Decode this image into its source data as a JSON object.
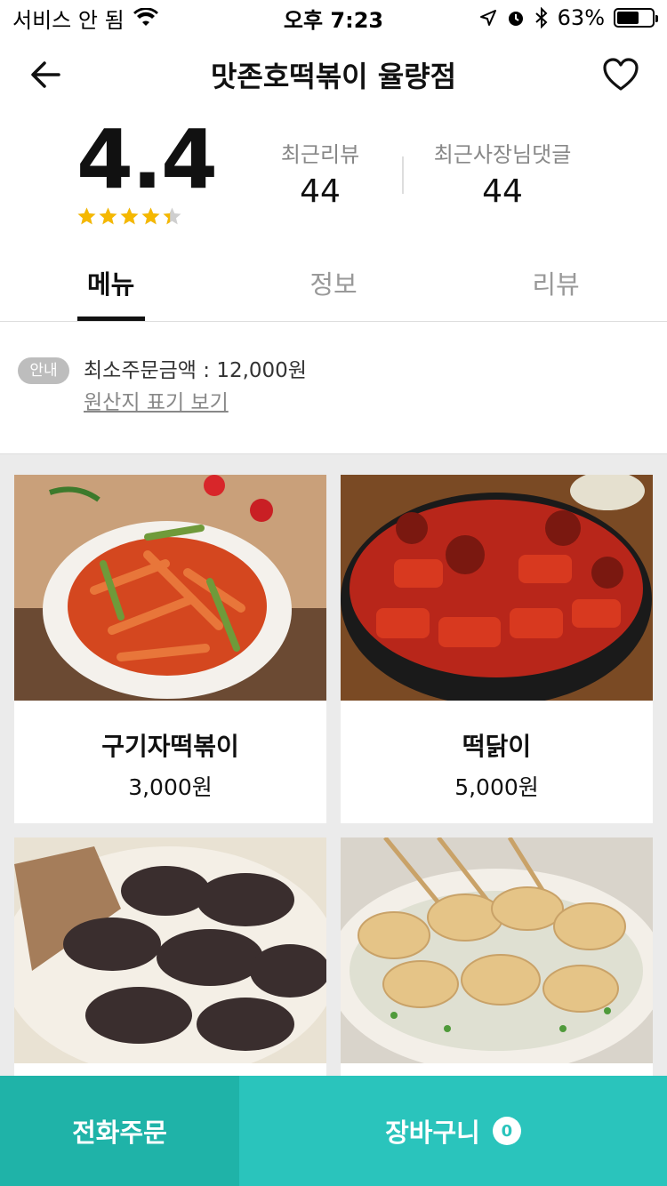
{
  "status_bar": {
    "carrier": "서비스 안 됨",
    "time": "오후 7:23",
    "battery": "63%",
    "battery_level": 0.63
  },
  "header": {
    "title": "맛존호떡볶이 율량점"
  },
  "summary": {
    "rating": "4.4",
    "rating_value": 4.4,
    "stats": [
      {
        "label": "최근리뷰",
        "value": "44"
      },
      {
        "label": "최근사장님댓글",
        "value": "44"
      }
    ]
  },
  "tabs": [
    {
      "label": "메뉴",
      "active": true
    },
    {
      "label": "정보",
      "active": false
    },
    {
      "label": "리뷰",
      "active": false
    }
  ],
  "notice": {
    "badge": "안내",
    "min_order": "최소주문금액 : 12,000원",
    "origin_link": "원산지 표기 보기"
  },
  "menu": [
    {
      "name": "구기자떡볶이",
      "price": "3,000원"
    },
    {
      "name": "떡닭이",
      "price": "5,000원"
    },
    {
      "name": "",
      "price": ""
    },
    {
      "name": "",
      "price": ""
    }
  ],
  "bottom": {
    "phone_order": "전화주문",
    "cart": "장바구니",
    "cart_count": "0"
  },
  "colors": {
    "accent_dark": "#1fb3a8",
    "accent": "#2ac4bc",
    "star": "#f5b800"
  }
}
